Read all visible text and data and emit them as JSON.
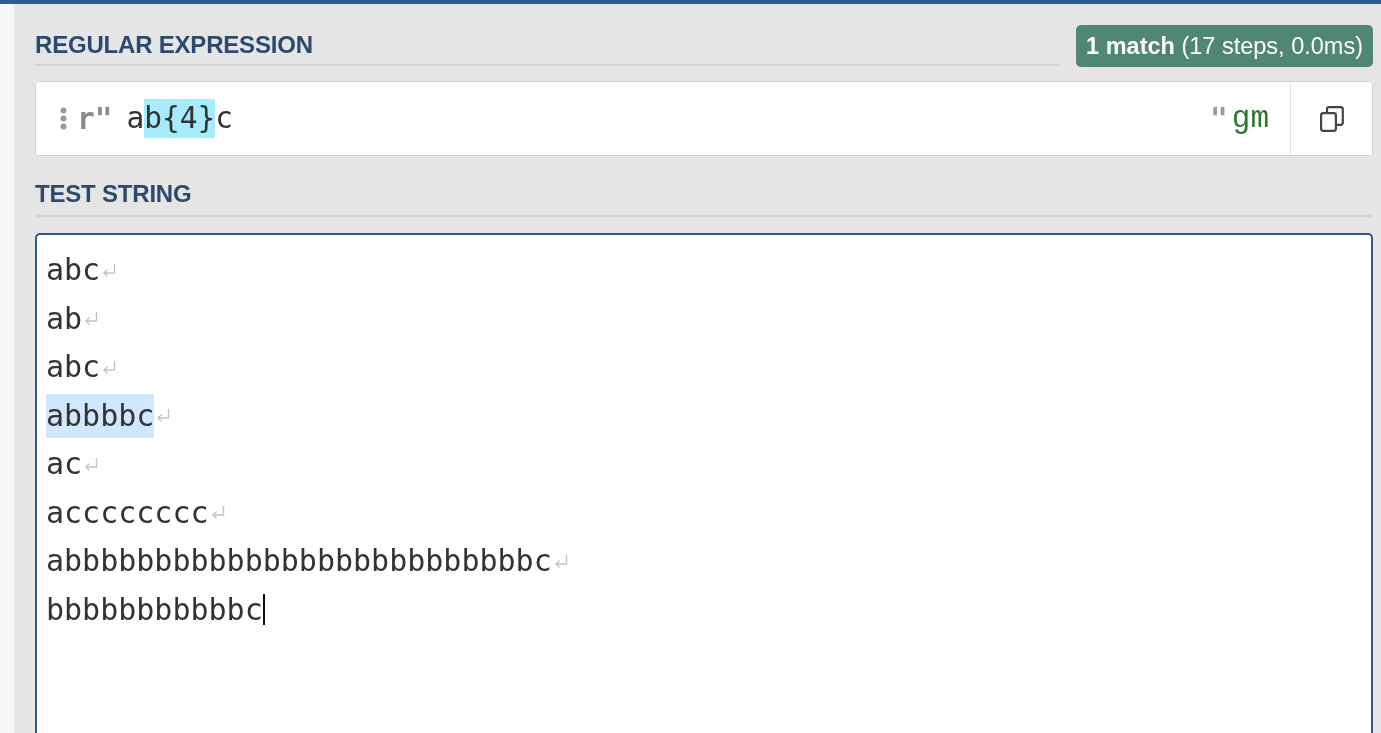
{
  "regex_section": {
    "title": "REGULAR EXPRESSION",
    "match_info": "**1 match** (17 steps, 0.0ms)",
    "prefix": "r\"",
    "tokens": [
      {
        "text": "a",
        "highlighted": false
      },
      {
        "text": "b{4}",
        "highlighted": true
      },
      {
        "text": "c",
        "highlighted": false
      }
    ],
    "suffix": "\"",
    "flags": "gm"
  },
  "test_string": {
    "title": "TEST STRING",
    "lines": [
      {
        "text": "abc",
        "matched": false,
        "newline": true,
        "cursor": false
      },
      {
        "text": "ab",
        "matched": false,
        "newline": true,
        "cursor": false
      },
      {
        "text": "abc",
        "matched": false,
        "newline": true,
        "cursor": false
      },
      {
        "text": "abbbbc",
        "matched": true,
        "newline": true,
        "cursor": false
      },
      {
        "text": "ac",
        "matched": false,
        "newline": true,
        "cursor": false
      },
      {
        "text": "acccccccc",
        "matched": false,
        "newline": true,
        "cursor": false
      },
      {
        "text": "abbbbbbbbbbbbbbbbbbbbbbbbbbc",
        "matched": false,
        "newline": true,
        "cursor": false
      },
      {
        "text": "bbbbbbbbbbbc",
        "matched": false,
        "newline": false,
        "cursor": true
      }
    ]
  }
}
